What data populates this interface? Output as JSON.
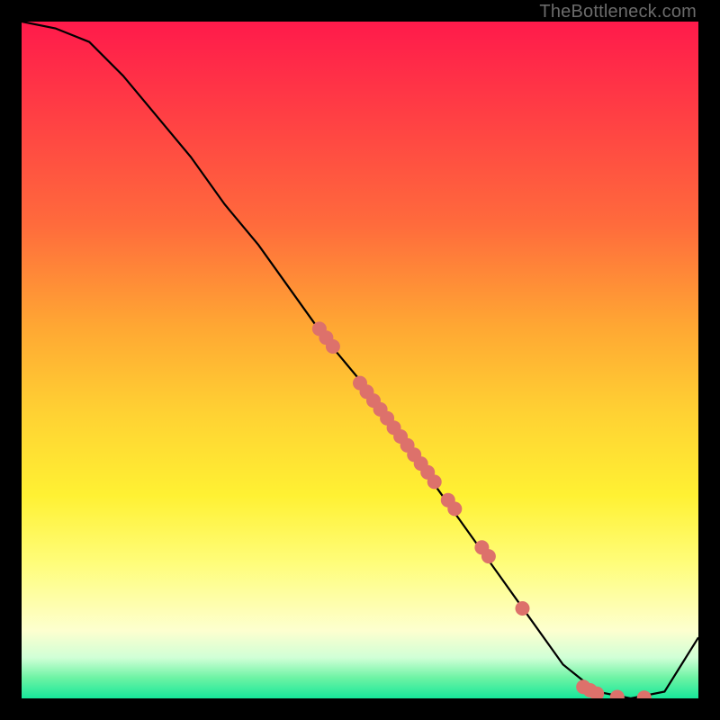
{
  "watermark": "TheBottleneck.com",
  "chart_data": {
    "type": "line",
    "title": "",
    "xlabel": "",
    "ylabel": "",
    "xlim": [
      0,
      100
    ],
    "ylim": [
      0,
      100
    ],
    "grid": false,
    "legend": false,
    "series": [
      {
        "name": "curve",
        "x": [
          0,
          5,
          10,
          15,
          20,
          25,
          30,
          35,
          40,
          45,
          50,
          55,
          60,
          65,
          70,
          75,
          80,
          85,
          90,
          95,
          100
        ],
        "y": [
          100,
          99,
          97,
          92,
          86,
          80,
          73,
          67,
          60,
          53,
          47,
          40,
          33,
          26,
          19,
          12,
          5,
          1,
          0,
          1,
          9
        ],
        "color": "#000000"
      }
    ],
    "scatter": {
      "name": "points-on-curve",
      "color": "#dd716b",
      "radius_px": 8,
      "points": [
        {
          "x": 44,
          "y": 54.6
        },
        {
          "x": 45,
          "y": 53.3
        },
        {
          "x": 46,
          "y": 52.0
        },
        {
          "x": 50,
          "y": 46.6
        },
        {
          "x": 51,
          "y": 45.3
        },
        {
          "x": 52,
          "y": 44.0
        },
        {
          "x": 53,
          "y": 42.7
        },
        {
          "x": 54,
          "y": 41.4
        },
        {
          "x": 55,
          "y": 40.0
        },
        {
          "x": 56,
          "y": 38.7
        },
        {
          "x": 57,
          "y": 37.4
        },
        {
          "x": 58,
          "y": 36.0
        },
        {
          "x": 59,
          "y": 34.7
        },
        {
          "x": 60,
          "y": 33.4
        },
        {
          "x": 61,
          "y": 32.0
        },
        {
          "x": 63,
          "y": 29.3
        },
        {
          "x": 64,
          "y": 28.0
        },
        {
          "x": 68,
          "y": 22.3
        },
        {
          "x": 69,
          "y": 21.0
        },
        {
          "x": 74,
          "y": 13.3
        },
        {
          "x": 83,
          "y": 1.7
        },
        {
          "x": 84,
          "y": 1.2
        },
        {
          "x": 85,
          "y": 0.7
        },
        {
          "x": 88,
          "y": 0.2
        },
        {
          "x": 92,
          "y": 0.1
        }
      ]
    },
    "background_gradient": {
      "top": "#ff1a4b",
      "mid": "#fff133",
      "bottom": "#17e79a"
    }
  }
}
